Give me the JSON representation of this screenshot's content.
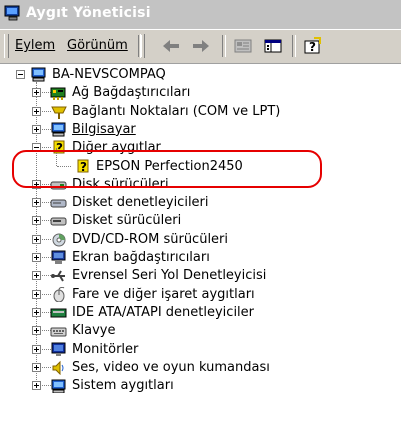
{
  "window": {
    "title": "Aygıt Yöneticisi"
  },
  "menu": {
    "action": "Eylem",
    "view": "Görünüm"
  },
  "toolbar_icons": [
    "back-arrow-icon",
    "forward-arrow-icon",
    "properties-icon",
    "tree-view-icon",
    "help-icon"
  ],
  "tree": {
    "root": "BA-NEVSCOMPAQ",
    "items": [
      {
        "label": "Ağ Bağdaştırıcıları",
        "icon": "network-adapter-icon",
        "state": "collapsed"
      },
      {
        "label": "Bağlantı Noktaları (COM ve LPT)",
        "icon": "port-icon",
        "state": "collapsed"
      },
      {
        "label": "Bilgisayar",
        "icon": "computer-icon",
        "state": "collapsed"
      },
      {
        "label": "Diğer aygıtlar",
        "icon": "unknown-device-icon",
        "state": "expanded"
      },
      {
        "label": "EPSON Perfection2450",
        "icon": "unknown-device-icon",
        "state": "child"
      },
      {
        "label": "Disk sürücüleri",
        "icon": "disk-drive-icon",
        "state": "collapsed"
      },
      {
        "label": "Disket denetleyicileri",
        "icon": "floppy-controller-icon",
        "state": "collapsed"
      },
      {
        "label": "Disket sürücüleri",
        "icon": "floppy-drive-icon",
        "state": "collapsed"
      },
      {
        "label": "DVD/CD-ROM sürücüleri",
        "icon": "cdrom-icon",
        "state": "collapsed"
      },
      {
        "label": "Ekran bağdaştırıcıları",
        "icon": "display-adapter-icon",
        "state": "collapsed"
      },
      {
        "label": "Evrensel Seri Yol Denetleyicisi",
        "icon": "usb-icon",
        "state": "collapsed"
      },
      {
        "label": "Fare ve diğer işaret aygıtları",
        "icon": "mouse-icon",
        "state": "collapsed"
      },
      {
        "label": "IDE ATA/ATAPI denetleyiciler",
        "icon": "ide-controller-icon",
        "state": "collapsed"
      },
      {
        "label": "Klavye",
        "icon": "keyboard-icon",
        "state": "collapsed"
      },
      {
        "label": "Monitörler",
        "icon": "monitor-icon",
        "state": "collapsed"
      },
      {
        "label": "Ses, video ve oyun kumandası",
        "icon": "sound-icon",
        "state": "collapsed"
      },
      {
        "label": "Sistem aygıtları",
        "icon": "system-devices-icon",
        "state": "collapsed"
      }
    ]
  },
  "colors": {
    "highlight": "#e60000",
    "warning_yellow": "#f5e000",
    "titlebar": "#c3c3c3"
  }
}
